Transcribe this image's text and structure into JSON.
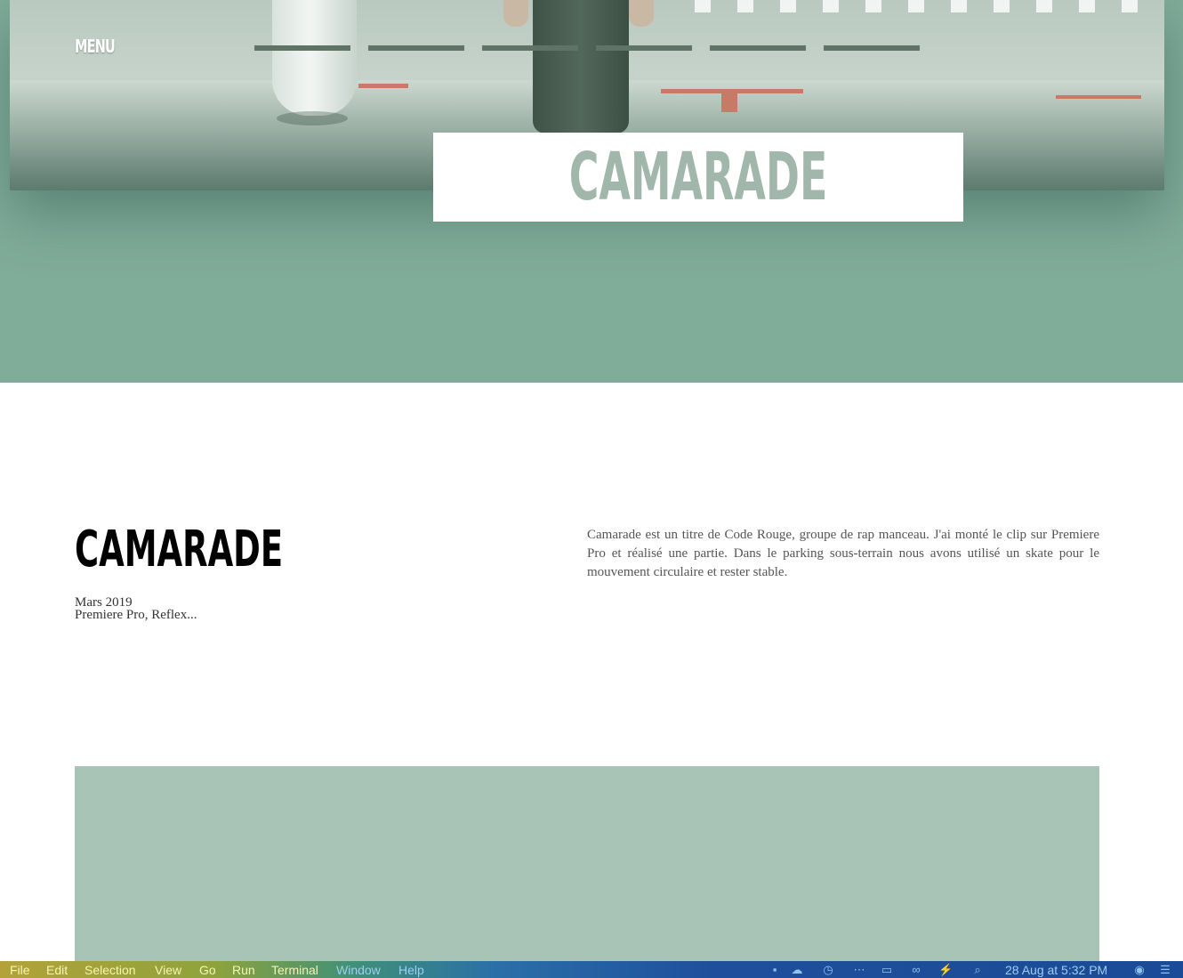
{
  "header": {
    "menu_label": "MENU",
    "hero_title": "CAMARADE"
  },
  "project": {
    "title": "CAMARADE",
    "date": "Mars 2019",
    "tools": "Premiere Pro, Reflex...",
    "description": "Camarade est un titre de Code Rouge, groupe de rap manceau. J'ai monté le clip sur Premiere Pro et réalisé une partie. Dans le parking sous-terrain nous avons utilisé un skate pour le mouvement circulaire et rester stable."
  },
  "colors": {
    "hero_background": "#80ac9a",
    "media_placeholder": "#a8c4b7",
    "title_text": "#a1b7ab"
  },
  "menubar": {
    "items": [
      "File",
      "Edit",
      "Selection",
      "View",
      "Go",
      "Run",
      "Terminal",
      "Window",
      "Help"
    ],
    "status_icons": [
      "dots-icon",
      "cloud-upload-icon",
      "time-machine-icon",
      "dots-horizontal-icon",
      "display-icon",
      "link-icon",
      "battery-charging-icon",
      "search-icon"
    ],
    "datetime": "28 Aug at  5:32 PM",
    "right_icons": [
      "siri-icon",
      "control-center-icon"
    ]
  }
}
